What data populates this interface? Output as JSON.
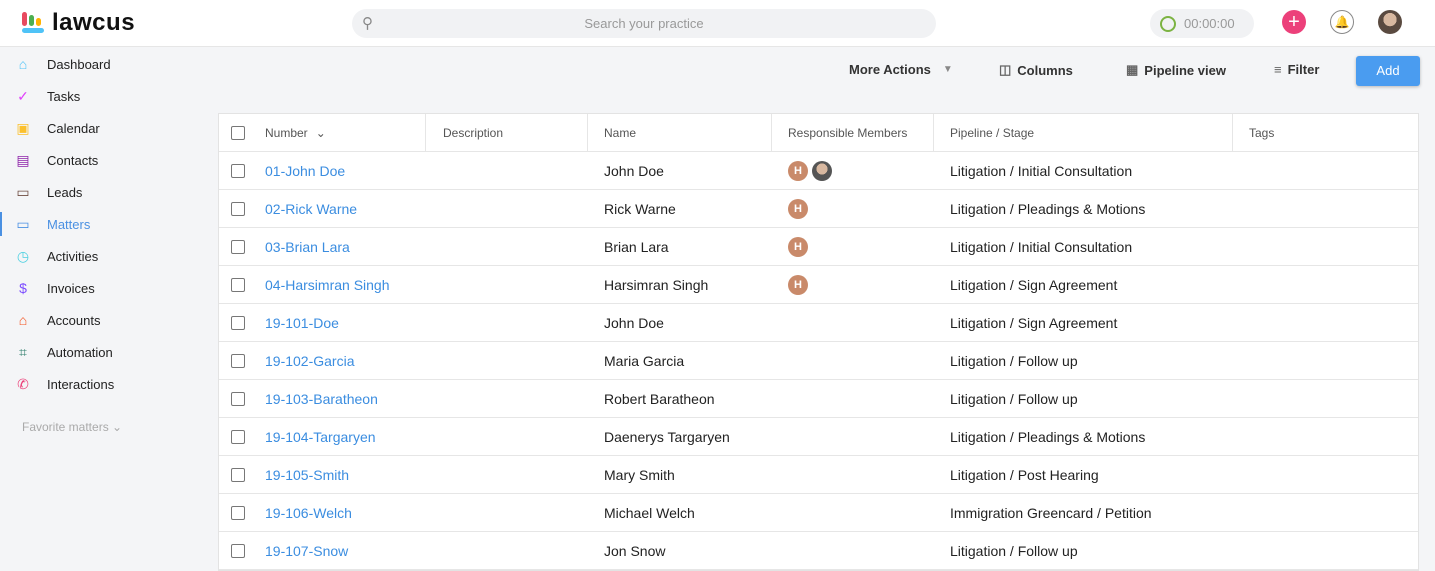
{
  "app": {
    "name": "lawcus"
  },
  "header": {
    "search_placeholder": "Search your practice",
    "timer": "00:00:00"
  },
  "sidebar": {
    "items": [
      {
        "label": "Dashboard",
        "icon": "home-icon",
        "color": "#4fc3f7"
      },
      {
        "label": "Tasks",
        "icon": "check-circle-icon",
        "color": "#e040fb"
      },
      {
        "label": "Calendar",
        "icon": "calendar-icon",
        "color": "#fbc02d"
      },
      {
        "label": "Contacts",
        "icon": "contact-card-icon",
        "color": "#8e24aa"
      },
      {
        "label": "Leads",
        "icon": "briefcase-arrow-icon",
        "color": "#6d4c41"
      },
      {
        "label": "Matters",
        "icon": "briefcase-icon",
        "color": "#4a90e2"
      },
      {
        "label": "Activities",
        "icon": "stopwatch-icon",
        "color": "#4dd0e1"
      },
      {
        "label": "Invoices",
        "icon": "dollar-circle-icon",
        "color": "#7c4dff"
      },
      {
        "label": "Accounts",
        "icon": "bank-icon",
        "color": "#f4511e"
      },
      {
        "label": "Automation",
        "icon": "crop-icon",
        "color": "#2e7d6b"
      },
      {
        "label": "Interactions",
        "icon": "phone-icon",
        "color": "#ec407a"
      }
    ],
    "favorites": "Favorite matters"
  },
  "toolbar": {
    "more_actions": "More Actions",
    "columns": "Columns",
    "pipeline": "Pipeline view",
    "filter": "Filter",
    "add": "Add"
  },
  "table": {
    "headers": [
      "Number",
      "Description",
      "Name",
      "Responsible Members",
      "Pipeline / Stage",
      "Tags"
    ],
    "rows": [
      {
        "number": "01-John Doe",
        "name": "John Doe",
        "members": [
          "H",
          "photo"
        ],
        "stage": "Litigation / Initial Consultation"
      },
      {
        "number": "02-Rick Warne",
        "name": "Rick Warne",
        "members": [
          "H"
        ],
        "stage": "Litigation / Pleadings & Motions"
      },
      {
        "number": "03-Brian Lara",
        "name": "Brian Lara",
        "members": [
          "H"
        ],
        "stage": "Litigation / Initial Consultation"
      },
      {
        "number": "04-Harsimran Singh",
        "name": "Harsimran Singh",
        "members": [
          "H"
        ],
        "stage": "Litigation / Sign Agreement"
      },
      {
        "number": "19-101-Doe",
        "name": "John Doe",
        "members": [],
        "stage": "Litigation / Sign Agreement"
      },
      {
        "number": "19-102-Garcia",
        "name": "Maria Garcia",
        "members": [],
        "stage": "Litigation / Follow up"
      },
      {
        "number": "19-103-Baratheon",
        "name": "Robert Baratheon",
        "members": [],
        "stage": "Litigation / Follow up"
      },
      {
        "number": "19-104-Targaryen",
        "name": "Daenerys Targaryen",
        "members": [],
        "stage": "Litigation / Pleadings & Motions"
      },
      {
        "number": "19-105-Smith",
        "name": "Mary Smith",
        "members": [],
        "stage": "Litigation / Post Hearing"
      },
      {
        "number": "19-106-Welch",
        "name": "Michael Welch",
        "members": [],
        "stage": "Immigration Greencard / Petition"
      },
      {
        "number": "19-107-Snow",
        "name": "Jon Snow",
        "members": [],
        "stage": "Litigation / Follow up"
      }
    ]
  }
}
